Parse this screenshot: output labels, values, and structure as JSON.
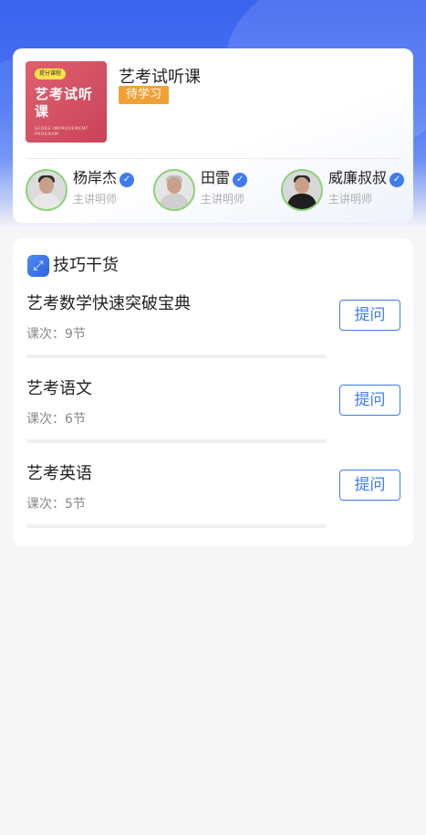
{
  "course": {
    "cover_tag": "提分课程",
    "cover_title": "艺考试听课",
    "cover_subtitle": "SCORE IMPROVEMENT PROGRAM",
    "title": "艺考试听课",
    "status": "待学习"
  },
  "teachers": [
    {
      "name": "杨岸杰",
      "role": "主讲明师"
    },
    {
      "name": "田雷",
      "role": "主讲明师"
    },
    {
      "name": "威廉叔叔",
      "role": "主讲明师"
    }
  ],
  "section": {
    "title": "技巧干货"
  },
  "lessons": [
    {
      "title": "艺考数学快速突破宝典",
      "count": "课次：9节",
      "button": "提问",
      "progress": 0
    },
    {
      "title": "艺考语文",
      "count": "课次：6节",
      "button": "提问",
      "progress": 0
    },
    {
      "title": "艺考英语",
      "count": "课次：5节",
      "button": "提问",
      "progress": 0
    }
  ],
  "colors": {
    "accent": "#3f7cf0",
    "status_badge": "#f0a135",
    "avatar_ring": "#8fd17a"
  }
}
